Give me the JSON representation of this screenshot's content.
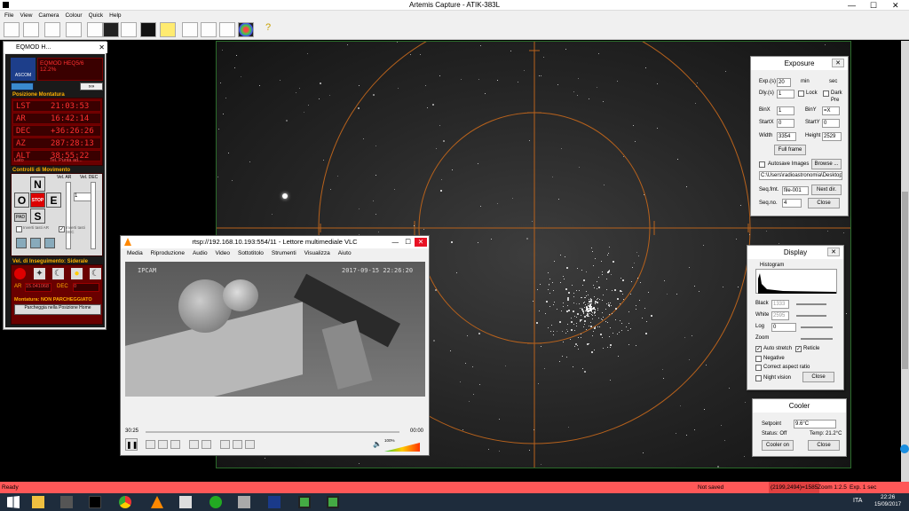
{
  "app": {
    "title": "Artemis Capture - ATIK-383L",
    "min": "—",
    "max": "☐",
    "close": "✕"
  },
  "menu": [
    "File",
    "View",
    "Camera",
    "Colour",
    "Quick",
    "Help"
  ],
  "eqmod": {
    "title": "EQMOD H...",
    "ascom": "ASCOM",
    "mount_line1": "EQMOD HEQ5/6",
    "mount_line2": "12.2%",
    "pos_header": "Posizione Montatura",
    "rows": [
      {
        "k": "LST",
        "v": "21:03:53"
      },
      {
        "k": "AR",
        "v": "16:42:14"
      },
      {
        "k": "DEC",
        "v": "+36:26:26"
      },
      {
        "k": "AZ",
        "v": "287:28:13"
      },
      {
        "k": "ALT",
        "v": "38:55:22"
      }
    ],
    "lat": "Lato",
    "side": "Tel. Punta ad...",
    "motion_header": "Controlli di Movimento",
    "vel_ar": "Vel. AR",
    "vel_dec": "Vel. DEC",
    "dirs": {
      "n": "N",
      "s": "S",
      "e": "E",
      "o": "O",
      "stop": "STOP"
    },
    "rate_val": "1",
    "pad": "PAD",
    "inv_ar": "Inverti tasti AR",
    "inv_dec": "Inverti tasti DEC",
    "track_header": "Vel. di Inseguimento: Siderale",
    "ar_lbl": "AR",
    "dec_lbl": "DEC",
    "ar_val": "15.041068",
    "dec_val": "0",
    "park_header": "Montatura: NON PARCHEGGIATO",
    "park_btn": "Parcheggia nella Posizione Home"
  },
  "exposure": {
    "title": "Exposure",
    "exp_lbl": "Exp.(s)",
    "exp": "20",
    "min": "min",
    "sec": "sec",
    "dly_lbl": "Dly.(s)",
    "dly": "1",
    "lock": "Lock",
    "dark": "Dark",
    "pre": "Pre",
    "binx_lbl": "BinX",
    "binx": "1",
    "biny_lbl": "BinY",
    "biny": "=X",
    "startx_lbl": "StartX",
    "startx": "0",
    "starty_lbl": "StartY",
    "starty": "0",
    "width_lbl": "Width",
    "width": "3354",
    "height_lbl": "Height",
    "height": "2529",
    "full": "Full frame",
    "autosave": "Autosave Images",
    "browse": "Browse ...",
    "path": "C:\\Users\\radioastronomia\\Desktop\\",
    "seqfmt_lbl": "Seq.fmt.",
    "seqfmt": "file-001",
    "nextdir": "Next dir.",
    "seqno_lbl": "Seq.no.",
    "seqno": "4",
    "close": "Close"
  },
  "display": {
    "title": "Display",
    "histogram": "Histogram",
    "black_lbl": "Black",
    "black": "1333",
    "white_lbl": "White",
    "white": "2595",
    "log_lbl": "Log",
    "log": "0",
    "zoom_lbl": "Zoom",
    "autostretch": "Auto stretch",
    "reticle": "Reticle",
    "negative": "Negative",
    "aspect": "Correct aspect ratio",
    "night": "Night vision",
    "close": "Close"
  },
  "cooler": {
    "title": "Cooler",
    "setpoint_lbl": "Setpoint",
    "setpoint": "9.6°C",
    "status": "Status: Off",
    "temp": "Temp: 21.2°C",
    "on": "Cooler on",
    "close": "Close"
  },
  "vlc": {
    "title": "rtsp://192.168.10.193:554/11 - Lettore multimediale VLC",
    "menu": [
      "Media",
      "Riproduzione",
      "Audio",
      "Video",
      "Sottotitolo",
      "Strumenti",
      "Visualizza",
      "Aiuto"
    ],
    "cam_label": "IPCAM",
    "timestamp": "2017-09-15 22:26:20",
    "time_left": "30:25",
    "time_right": "00:00",
    "volume": "100%"
  },
  "status": {
    "text": "Ready",
    "saved": "Not saved",
    "coords": "(2199,2494)=1585",
    "zoom": "Zoom 1:2.5",
    "exp": "Exp. 1 sec"
  },
  "tray": {
    "lang": "ITA",
    "time": "22:26",
    "date": "15/09/2017"
  },
  "colors": {
    "reticle": "#b8621c",
    "status": "#ff5858",
    "led": "#ff3030"
  }
}
